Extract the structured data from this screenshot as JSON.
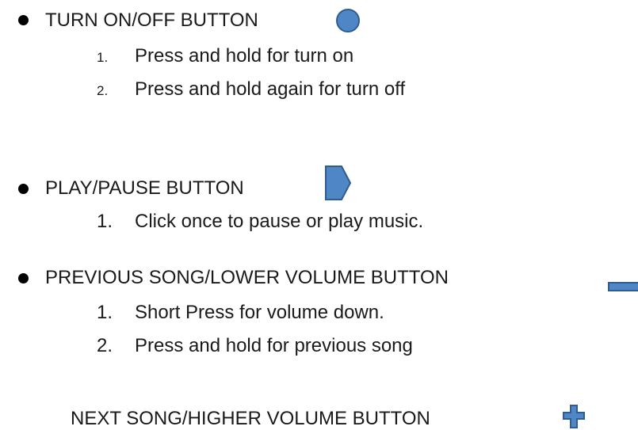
{
  "sections": [
    {
      "heading": "TURN ON/OFF BUTTON",
      "icon": "circle-button-icon",
      "steps": [
        {
          "num": "1.",
          "text": "Press and hold for turn on"
        },
        {
          "num": "2.",
          "text": "Press and hold again for turn off"
        }
      ]
    },
    {
      "heading": "PLAY/PAUSE BUTTON",
      "icon": "play-pause-arrow-icon",
      "steps": [
        {
          "num": "1.",
          "text": "Click once to pause or play music."
        }
      ]
    },
    {
      "heading": "PREVIOUS SONG/LOWER VOLUME BUTTON",
      "icon": "minus-button-icon",
      "steps": [
        {
          "num": "1.",
          "text": "Short Press for volume down."
        },
        {
          "num": "2.",
          "text": "Press and hold for previous song"
        }
      ]
    },
    {
      "heading": "NEXT SONG/HIGHER VOLUME BUTTON",
      "icon": "plus-button-icon",
      "steps": []
    }
  ],
  "colors": {
    "icon_fill": "#4f86c6",
    "icon_stroke": "#2f5c93",
    "text": "#1a1a1a",
    "bullet": "#000000"
  }
}
